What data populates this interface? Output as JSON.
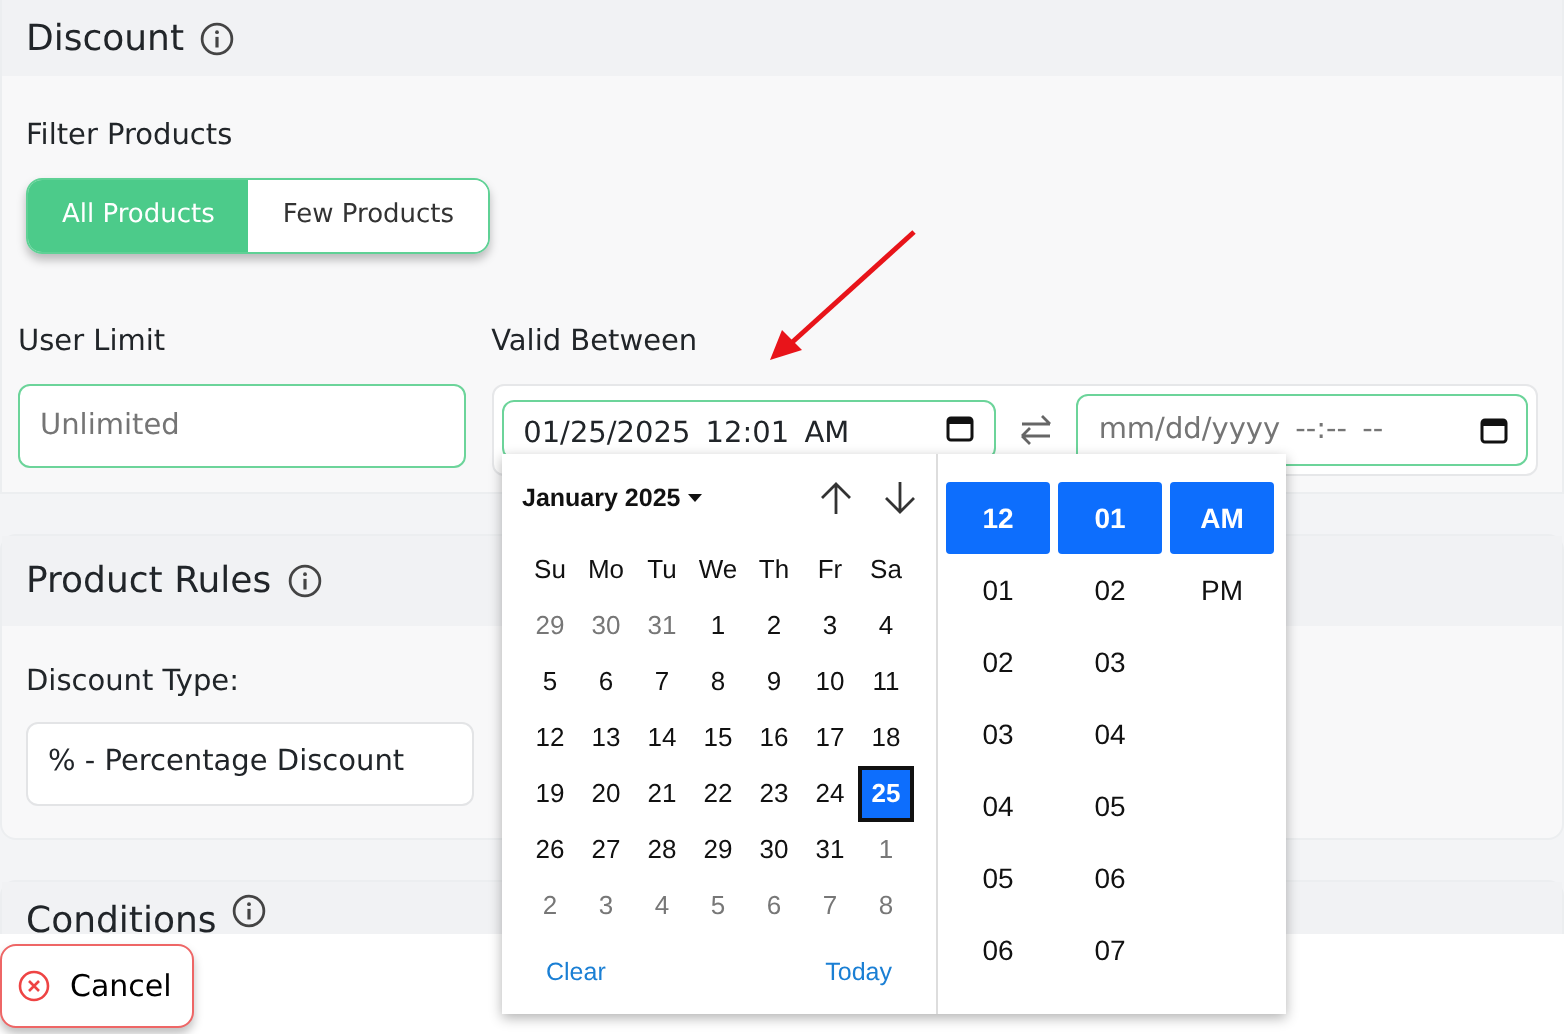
{
  "discount": {
    "title": "Discount",
    "filter_label": "Filter Products",
    "filter_options": [
      {
        "label": "All Products",
        "selected": true
      },
      {
        "label": "Few Products",
        "selected": false
      }
    ],
    "user_limit": {
      "label": "User Limit",
      "placeholder": "Unlimited"
    },
    "valid_between": {
      "label": "Valid Between",
      "start": {
        "value": "01/25/2025 12:01 AM"
      },
      "end": {
        "placeholder": "mm/dd/yyyy --:-- --"
      }
    }
  },
  "product_rules": {
    "title": "Product Rules",
    "discount_type_label": "Discount Type:",
    "discount_type": "% - Percentage Discount"
  },
  "conditions": {
    "title": "Conditions"
  },
  "cancel_button": "Cancel",
  "picker": {
    "month": "January 2025",
    "weekdays": [
      "Su",
      "Mo",
      "Tu",
      "We",
      "Th",
      "Fr",
      "Sa"
    ],
    "days": [
      {
        "label": "29",
        "outside": true,
        "selected": false
      },
      {
        "label": "30",
        "outside": true,
        "selected": false
      },
      {
        "label": "31",
        "outside": true,
        "selected": false
      },
      {
        "label": "1",
        "outside": false,
        "selected": false
      },
      {
        "label": "2",
        "outside": false,
        "selected": false
      },
      {
        "label": "3",
        "outside": false,
        "selected": false
      },
      {
        "label": "4",
        "outside": false,
        "selected": false
      },
      {
        "label": "5",
        "outside": false,
        "selected": false
      },
      {
        "label": "6",
        "outside": false,
        "selected": false
      },
      {
        "label": "7",
        "outside": false,
        "selected": false
      },
      {
        "label": "8",
        "outside": false,
        "selected": false
      },
      {
        "label": "9",
        "outside": false,
        "selected": false
      },
      {
        "label": "10",
        "outside": false,
        "selected": false
      },
      {
        "label": "11",
        "outside": false,
        "selected": false
      },
      {
        "label": "12",
        "outside": false,
        "selected": false
      },
      {
        "label": "13",
        "outside": false,
        "selected": false
      },
      {
        "label": "14",
        "outside": false,
        "selected": false
      },
      {
        "label": "15",
        "outside": false,
        "selected": false
      },
      {
        "label": "16",
        "outside": false,
        "selected": false
      },
      {
        "label": "17",
        "outside": false,
        "selected": false
      },
      {
        "label": "18",
        "outside": false,
        "selected": false
      },
      {
        "label": "19",
        "outside": false,
        "selected": false
      },
      {
        "label": "20",
        "outside": false,
        "selected": false
      },
      {
        "label": "21",
        "outside": false,
        "selected": false
      },
      {
        "label": "22",
        "outside": false,
        "selected": false
      },
      {
        "label": "23",
        "outside": false,
        "selected": false
      },
      {
        "label": "24",
        "outside": false,
        "selected": false
      },
      {
        "label": "25",
        "outside": false,
        "selected": true
      },
      {
        "label": "26",
        "outside": false,
        "selected": false
      },
      {
        "label": "27",
        "outside": false,
        "selected": false
      },
      {
        "label": "28",
        "outside": false,
        "selected": false
      },
      {
        "label": "29",
        "outside": false,
        "selected": false
      },
      {
        "label": "30",
        "outside": false,
        "selected": false
      },
      {
        "label": "31",
        "outside": false,
        "selected": false
      },
      {
        "label": "1",
        "outside": true,
        "selected": false
      },
      {
        "label": "2",
        "outside": true,
        "selected": false
      },
      {
        "label": "3",
        "outside": true,
        "selected": false
      },
      {
        "label": "4",
        "outside": true,
        "selected": false
      },
      {
        "label": "5",
        "outside": true,
        "selected": false
      },
      {
        "label": "6",
        "outside": true,
        "selected": false
      },
      {
        "label": "7",
        "outside": true,
        "selected": false
      },
      {
        "label": "8",
        "outside": true,
        "selected": false
      }
    ],
    "clear": "Clear",
    "today": "Today",
    "hours": [
      {
        "label": "12",
        "selected": true
      },
      {
        "label": "01",
        "selected": false
      },
      {
        "label": "02",
        "selected": false
      },
      {
        "label": "03",
        "selected": false
      },
      {
        "label": "04",
        "selected": false
      },
      {
        "label": "05",
        "selected": false
      },
      {
        "label": "06",
        "selected": false
      }
    ],
    "minutes": [
      {
        "label": "01",
        "selected": true
      },
      {
        "label": "02",
        "selected": false
      },
      {
        "label": "03",
        "selected": false
      },
      {
        "label": "04",
        "selected": false
      },
      {
        "label": "05",
        "selected": false
      },
      {
        "label": "06",
        "selected": false
      },
      {
        "label": "07",
        "selected": false
      }
    ],
    "periods": [
      {
        "label": "AM",
        "selected": true
      },
      {
        "label": "PM",
        "selected": false
      }
    ]
  }
}
